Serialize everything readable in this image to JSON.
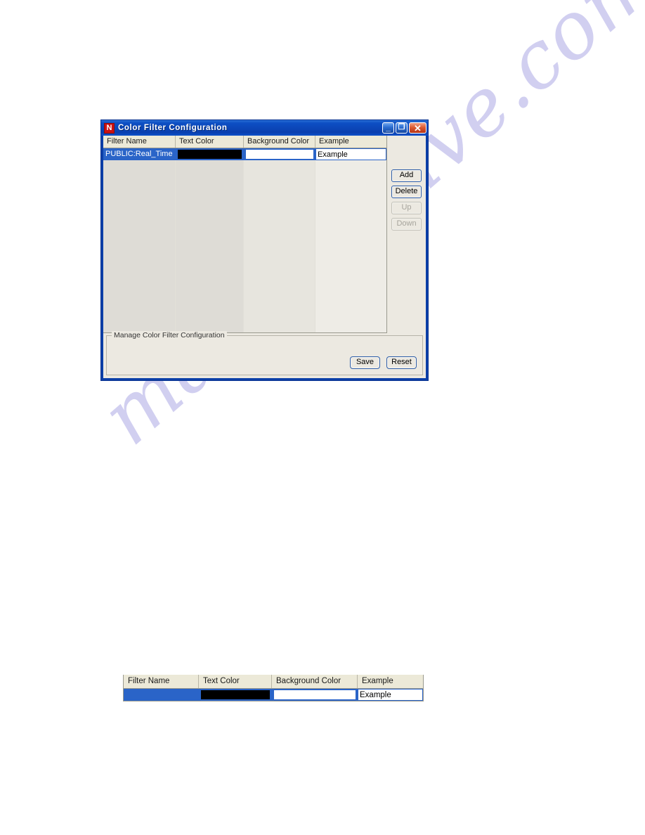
{
  "watermark": {
    "text": "manualshive.com"
  },
  "window": {
    "title": "Color Filter Configuration",
    "icon_label": "N",
    "icon_name": "app-logo-n-icon",
    "controls": {
      "minimize": "_",
      "maximize": "❐",
      "close": "✕"
    }
  },
  "table": {
    "columns": [
      "Filter Name",
      "Text Color",
      "Background Color",
      "Example"
    ],
    "rows": [
      {
        "filter_name": "PUBLIC:Real_Time",
        "text_color": "#000000",
        "background_color": "#ffffff",
        "example": "Example",
        "selected": true
      }
    ]
  },
  "side_buttons": [
    {
      "label": "Add",
      "enabled": true
    },
    {
      "label": "Delete",
      "enabled": true
    },
    {
      "label": "Up",
      "enabled": false
    },
    {
      "label": "Down",
      "enabled": false
    }
  ],
  "group_box": {
    "title": "Manage Color Filter Configuration",
    "buttons": [
      {
        "label": "Save"
      },
      {
        "label": "Reset"
      }
    ]
  },
  "detail_figure": {
    "columns": [
      "Filter Name",
      "Text Color",
      "Background Color",
      "Example"
    ],
    "row": {
      "filter_name": "",
      "text_color": "#000000",
      "background_color": "#ffffff",
      "example": "Example"
    }
  },
  "colors": {
    "titlebar_blue": "#0d4fc4",
    "selection_blue": "#2a64c8",
    "header_beige": "#ece9d8",
    "dialog_face": "#ece9e1",
    "button_border": "#2f5ea8",
    "close_red": "#de5a32",
    "logo_red": "#cc1111",
    "watermark_lavender": "#c9c7ee"
  }
}
